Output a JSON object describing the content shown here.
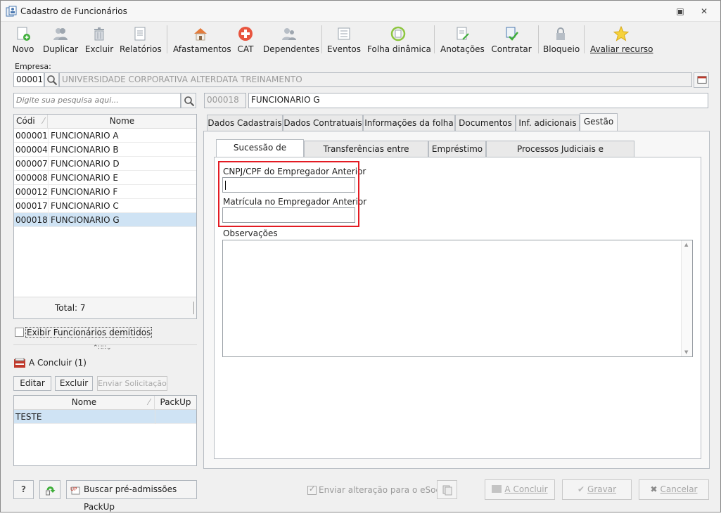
{
  "window": {
    "title": "Cadastro de Funcionários",
    "controls": {
      "restore": "▣",
      "close": "✕"
    }
  },
  "toolbar": {
    "items": [
      {
        "label": "Novo",
        "icon": "new-document-icon"
      },
      {
        "label": "Duplicar",
        "icon": "duplicate-people-icon"
      },
      {
        "label": "Excluir",
        "icon": "trash-icon"
      },
      {
        "label": "Relatórios",
        "icon": "report-icon"
      },
      {
        "label": "Afastamentos",
        "icon": "house-icon"
      },
      {
        "label": "CAT",
        "icon": "red-cross-icon"
      },
      {
        "label": "Dependentes",
        "icon": "people-icon"
      },
      {
        "label": "Eventos",
        "icon": "list-icon"
      },
      {
        "label": "Folha dinâmica",
        "icon": "refresh-document-icon"
      },
      {
        "label": "Anotações",
        "icon": "notes-icon"
      },
      {
        "label": "Contratar",
        "icon": "hire-check-icon"
      },
      {
        "label": "Bloqueio",
        "icon": "lock-icon"
      },
      {
        "label": "Avaliar recurso",
        "icon": "star-icon"
      }
    ]
  },
  "empresa": {
    "label": "Empresa:",
    "code": "00001",
    "name": "UNIVERSIDADE CORPORATIVA ALTERDATA TREINAMENTO"
  },
  "search": {
    "placeholder": "Digite sua pesquisa aqui..."
  },
  "employee": {
    "code": "000018",
    "name": "FUNCIONARIO G"
  },
  "employees_grid": {
    "columns": [
      "Códi",
      "Nome"
    ],
    "rows": [
      {
        "code": "000001",
        "name": "FUNCIONARIO A"
      },
      {
        "code": "000004",
        "name": "FUNCIONARIO B"
      },
      {
        "code": "000007",
        "name": "FUNCIONARIO D"
      },
      {
        "code": "000008",
        "name": "FUNCIONARIO E"
      },
      {
        "code": "000012",
        "name": "FUNCIONARIO F"
      },
      {
        "code": "000017",
        "name": "FUNCIONARIO C"
      },
      {
        "code": "000018",
        "name": "FUNCIONARIO G"
      }
    ],
    "selected_code": "000018",
    "total": "Total: 7"
  },
  "show_dismissed": {
    "label": "Exibir Funcionários demitidos",
    "checked": false
  },
  "splitter": "⌃∷∷⌄",
  "pending": {
    "title": "A Concluir (1)",
    "buttons": {
      "edit": "Editar",
      "delete": "Excluir",
      "send": "Enviar Solicitação"
    },
    "columns": [
      "Nome",
      "PackUp"
    ],
    "rows": [
      {
        "name": "TESTE",
        "packup": ""
      }
    ]
  },
  "main_tabs": {
    "items": [
      "Dados Cadastrais",
      "Dados Contratuais",
      "Informações da folha",
      "Documentos",
      "Inf. adicionais",
      "Gestão"
    ],
    "active": "Gestão"
  },
  "sub_tabs": {
    "items": [
      "Sucessão de Vínculo",
      "Transferências entre Empresas",
      "Empréstimo",
      "Processos Judiciais e Administrativos"
    ],
    "active": "Sucessão de Vínculo"
  },
  "form": {
    "cnpj_label": "CNPJ/CPF do Empregador Anterior",
    "cnpj_value": "",
    "matricula_label": "Matrícula no Empregador Anterior",
    "matricula_value": "",
    "obs_label": "Observações",
    "obs_value": ""
  },
  "footer": {
    "help": "?",
    "packup_button": "Buscar pré-admissões PackUp",
    "esocial_label": "Enviar alteração para o eSocial",
    "esocial_checked": true,
    "conclude": "A Concluir",
    "save": "Gravar",
    "cancel": "Cancelar"
  },
  "colors": {
    "highlight": "#e31b23",
    "selection": "#cfe3f4",
    "accent_green": "#3fae3a"
  }
}
